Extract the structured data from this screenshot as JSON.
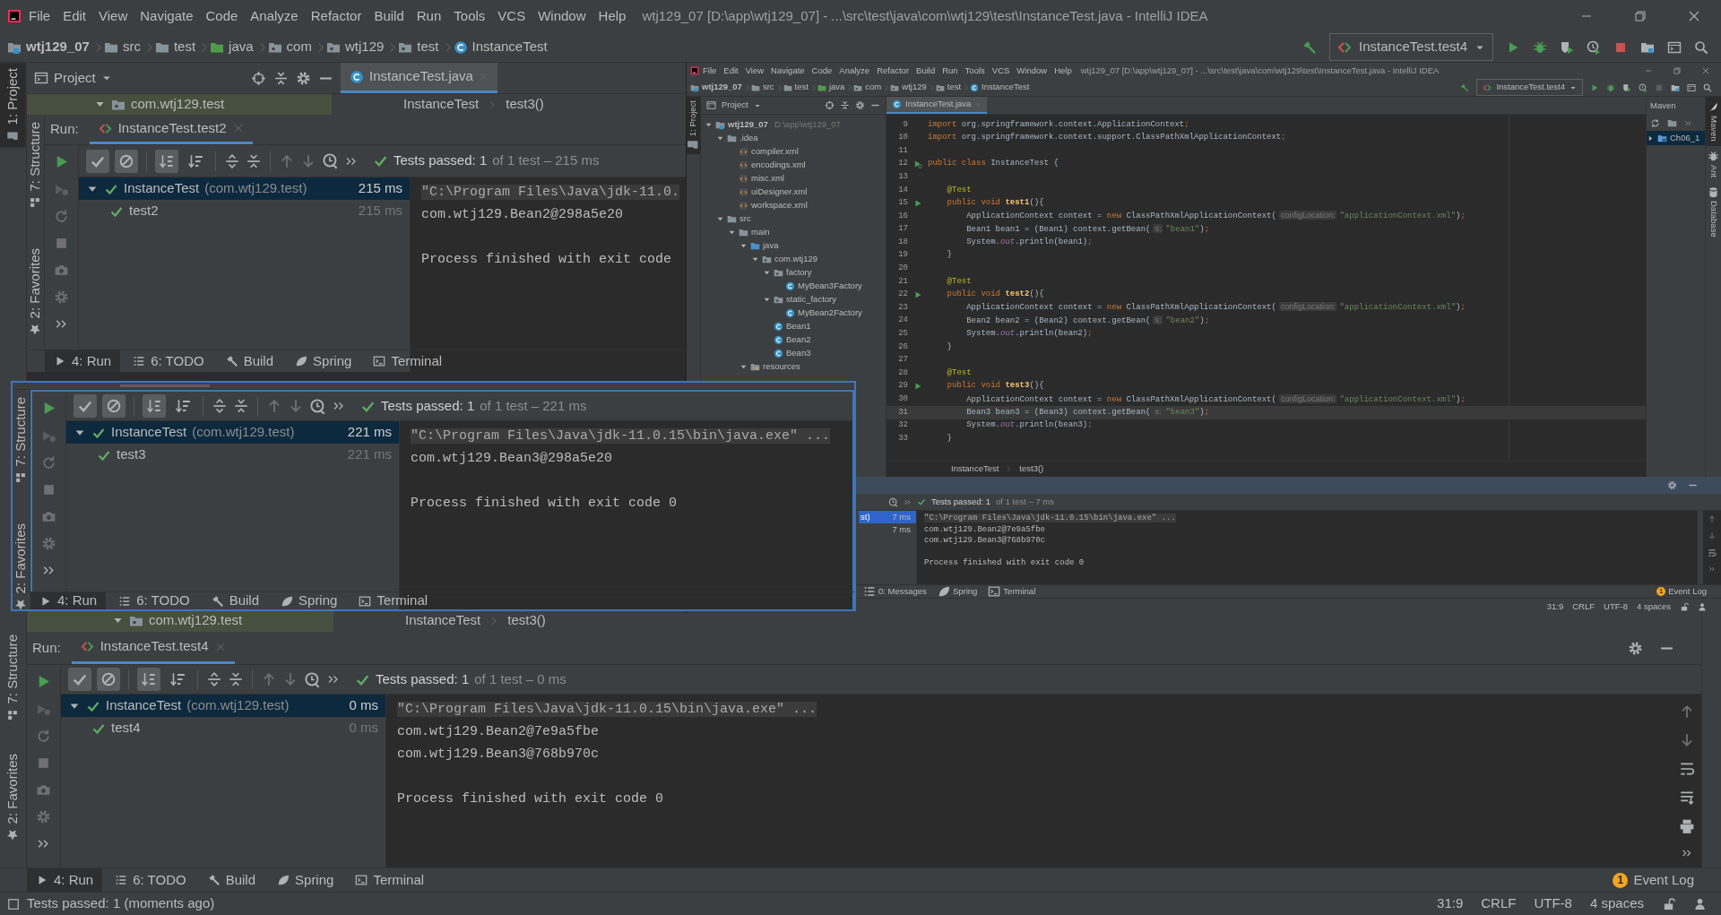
{
  "window": {
    "title": "wtj129_07 [D:\\app\\wtj129_07] - ...\\src\\test\\java\\com\\wtj129\\test\\InstanceTest.java - IntelliJ IDEA",
    "menu": [
      "File",
      "Edit",
      "View",
      "Navigate",
      "Code",
      "Analyze",
      "Refactor",
      "Build",
      "Run",
      "Tools",
      "VCS",
      "Window",
      "Help"
    ]
  },
  "navigation_bar": {
    "crumbs": [
      {
        "kind": "project",
        "label": "wtj129_07"
      },
      {
        "kind": "folder",
        "label": "src"
      },
      {
        "kind": "folder",
        "label": "test"
      },
      {
        "kind": "source",
        "label": "java"
      },
      {
        "kind": "package",
        "label": "com"
      },
      {
        "kind": "package",
        "label": "wtj129"
      },
      {
        "kind": "package",
        "label": "test"
      },
      {
        "kind": "class",
        "label": "InstanceTest"
      }
    ],
    "run_config": "InstanceTest.test4",
    "stop_active": true
  },
  "left_stripe": {
    "top": [
      "1: Project"
    ],
    "bottom": [
      "7: Structure",
      "2: Favorites"
    ]
  },
  "project_panel": {
    "title": "Project"
  },
  "editor_tabs": [
    {
      "label": "InstanceTest.java",
      "selected": true
    }
  ],
  "editor_breadcrumb": {
    "package": "com.wtj129.test",
    "path": [
      "InstanceTest",
      "test3()"
    ]
  },
  "run_panel": {
    "title": "Run:",
    "tab": "InstanceTest.test4",
    "toolbar": {
      "show_passed": true,
      "show_ignored": true,
      "sort_alphabetically": true,
      "sort_by_duration": false
    },
    "summary": {
      "passed": true,
      "status": "Tests passed: 1",
      "detail": "of 1 test – 0 ms"
    },
    "tree": [
      {
        "name": "InstanceTest",
        "package": "(com.wtj129.test)",
        "time": "0 ms",
        "passed": true,
        "selected": true,
        "expanded": true,
        "children": [
          {
            "name": "test4",
            "time": "0 ms",
            "passed": true,
            "selected": false
          }
        ]
      }
    ],
    "console": [
      {
        "kind": "command",
        "text": "\"C:\\Program Files\\Java\\jdk-11.0.15\\bin\\java.exe\" ..."
      },
      {
        "kind": "output",
        "text": "com.wtj129.Bean2@7e9a5fbe"
      },
      {
        "kind": "output",
        "text": "com.wtj129.Bean3@768b970c"
      },
      {
        "kind": "exit",
        "text": "Process finished with exit code 0"
      }
    ]
  },
  "tool_tabs": [
    {
      "label": "4: Run",
      "selected": true
    },
    {
      "label": "6: TODO",
      "selected": false
    },
    {
      "label": "Build",
      "selected": false
    },
    {
      "label": "Spring",
      "selected": false
    },
    {
      "label": "Terminal",
      "selected": false
    }
  ],
  "event_log": {
    "label": "Event Log",
    "count": "1"
  },
  "status_bar": {
    "message": "Tests passed: 1 (moments ago)",
    "items": [
      "31:9",
      "CRLF",
      "UTF-8",
      "4 spaces"
    ]
  },
  "pasted_run_panels": [
    {
      "breadcrumb": {
        "package": "com.wtj129.test",
        "path": [
          "InstanceTest",
          "test3()"
        ]
      },
      "title": "Run:",
      "tab": "InstanceTest.test2",
      "stripe": [
        "7: Structure",
        "2: Favorites"
      ],
      "toolbar": {
        "show_passed": true,
        "show_ignored": true,
        "sort_alphabetically": true,
        "sort_by_duration": false
      },
      "summary": {
        "passed": true,
        "status": "Tests passed: 1",
        "detail": "of 1 test – 215 ms"
      },
      "tree": [
        {
          "name": "InstanceTest",
          "package": "(com.wtj129.test)",
          "time": "215 ms",
          "passed": true,
          "selected": true,
          "expanded": true,
          "children": [
            {
              "name": "test2",
              "time": "215 ms",
              "passed": true,
              "selected": false
            }
          ]
        }
      ],
      "console": [
        {
          "kind": "command",
          "text": "\"C:\\Program Files\\Java\\jdk-11.0."
        },
        {
          "kind": "output",
          "text": "com.wtj129.Bean2@298a5e20"
        },
        {
          "kind": "exit",
          "text": "Process finished with exit code"
        }
      ],
      "tool_tabs": [
        {
          "label": "4: Run",
          "selected": true
        },
        {
          "label": "6: TODO",
          "selected": false
        },
        {
          "label": "Build",
          "selected": false
        },
        {
          "label": "Spring",
          "selected": false
        },
        {
          "label": "Terminal",
          "selected": false
        }
      ]
    },
    {
      "stripe": [
        "7: Structure",
        "2: Favorites"
      ],
      "toolbar": {
        "show_passed": true,
        "show_ignored": true,
        "sort_alphabetically": true,
        "sort_by_duration": false
      },
      "summary": {
        "passed": true,
        "status": "Tests passed: 1",
        "detail": "of 1 test – 221 ms"
      },
      "tree": [
        {
          "name": "InstanceTest",
          "package": "(com.wtj129.test)",
          "time": "221 ms",
          "passed": true,
          "selected": true,
          "expanded": true,
          "children": [
            {
              "name": "test3",
              "time": "221 ms",
              "passed": true,
              "selected": false
            }
          ]
        }
      ],
      "console": [
        {
          "kind": "command",
          "text": "\"C:\\Program Files\\Java\\jdk-11.0.15\\bin\\java.exe\" ..."
        },
        {
          "kind": "output",
          "text": "com.wtj129.Bean3@298a5e20"
        },
        {
          "kind": "exit",
          "text": "Process finished with exit code 0"
        }
      ],
      "tool_tabs": [
        {
          "label": "4: Run",
          "selected": true
        },
        {
          "label": "6: TODO",
          "selected": false
        },
        {
          "label": "Build",
          "selected": false
        },
        {
          "label": "Spring",
          "selected": false
        },
        {
          "label": "Terminal",
          "selected": false
        }
      ]
    }
  ],
  "pasted_ide": {
    "title": "wtj129_07 [D:\\app\\wtj129_07] - ...\\src\\test\\java\\com\\wtj129\\test\\InstanceTest.java - IntelliJ IDEA",
    "menu": [
      "File",
      "Edit",
      "View",
      "Navigate",
      "Code",
      "Analyze",
      "Refactor",
      "Build",
      "Run",
      "Tools",
      "VCS",
      "Window",
      "Help"
    ],
    "crumbs": [
      {
        "kind": "project",
        "label": "wtj129_07"
      },
      {
        "kind": "folder",
        "label": "src"
      },
      {
        "kind": "folder",
        "label": "test"
      },
      {
        "kind": "source",
        "label": "java"
      },
      {
        "kind": "package",
        "label": "com"
      },
      {
        "kind": "package",
        "label": "wtj129"
      },
      {
        "kind": "package",
        "label": "test"
      },
      {
        "kind": "class",
        "label": "InstanceTest"
      }
    ],
    "run_config": "InstanceTest.test4",
    "stop_active": false,
    "left_stripe": [
      "1: Project"
    ],
    "project_panel": {
      "title": "Project",
      "tree": [
        {
          "name": "wtj129_07",
          "path": "D:\\app\\wtj129_07",
          "kind": "project",
          "expanded": true,
          "children": [
            {
              "name": ".idea",
              "kind": "folder",
              "expanded": true,
              "children": [
                {
                  "name": "compiler.xml",
                  "kind": "xml"
                },
                {
                  "name": "encodings.xml",
                  "kind": "xml"
                },
                {
                  "name": "misc.xml",
                  "kind": "xml"
                },
                {
                  "name": "uiDesigner.xml",
                  "kind": "xml"
                },
                {
                  "name": "workspace.xml",
                  "kind": "xml"
                }
              ]
            },
            {
              "name": "src",
              "kind": "folder",
              "expanded": true,
              "children": [
                {
                  "name": "main",
                  "kind": "folder",
                  "expanded": true,
                  "children": [
                    {
                      "name": "java",
                      "kind": "source",
                      "expanded": true,
                      "children": [
                        {
                          "name": "com.wtj129",
                          "kind": "package",
                          "expanded": true,
                          "children": [
                            {
                              "name": "factory",
                              "kind": "package",
                              "expanded": true,
                              "children": [
                                {
                                  "name": "MyBean3Factory",
                                  "kind": "class"
                                }
                              ]
                            },
                            {
                              "name": "static_factory",
                              "kind": "package",
                              "expanded": true,
                              "children": [
                                {
                                  "name": "MyBean2Factory",
                                  "kind": "class"
                                }
                              ]
                            },
                            {
                              "name": "Bean1",
                              "kind": "class"
                            },
                            {
                              "name": "Bean2",
                              "kind": "class"
                            },
                            {
                              "name": "Bean3",
                              "kind": "class"
                            }
                          ]
                        }
                      ]
                    },
                    {
                      "name": "resources",
                      "kind": "resources",
                      "expanded": true
                    }
                  ]
                }
              ]
            }
          ]
        }
      ]
    },
    "editor_tabs": [
      {
        "label": "InstanceTest.java",
        "selected": true
      }
    ],
    "code": [
      {
        "number": "9",
        "current": false,
        "tokens": [
          {
            "kind": "keyword",
            "text": "import"
          },
          {
            "kind": "plain",
            "text": " org.springframework.context.ApplicationContext"
          },
          {
            "kind": "keyword",
            "text": ";"
          }
        ]
      },
      {
        "number": "10",
        "current": false,
        "tokens": [
          {
            "kind": "keyword",
            "text": "import"
          },
          {
            "kind": "plain",
            "text": " org.springframework.context.support.ClassPathXmlApplicationContext"
          },
          {
            "kind": "keyword",
            "text": ";"
          }
        ]
      },
      {
        "number": "11",
        "current": false
      },
      {
        "number": "12",
        "current": false,
        "kind": "run_class",
        "tokens": [
          {
            "kind": "keyword",
            "text": "public class "
          },
          {
            "kind": "plain",
            "text": "InstanceTest {"
          }
        ]
      },
      {
        "number": "13",
        "current": false
      },
      {
        "number": "14",
        "current": false,
        "tokens": [
          {
            "kind": "annotation",
            "text": "    @Test"
          }
        ]
      },
      {
        "number": "15",
        "current": false,
        "kind": "run",
        "tokens": [
          {
            "kind": "keyword",
            "text": "    public void "
          },
          {
            "kind": "method",
            "text": "test1"
          },
          {
            "kind": "plain",
            "text": "(){"
          }
        ]
      },
      {
        "number": "16",
        "current": false,
        "tokens": [
          {
            "kind": "plain",
            "text": "        ApplicationContext context = "
          },
          {
            "kind": "keyword",
            "text": "new "
          },
          {
            "kind": "plain",
            "text": "ClassPathXmlApplicationContext("
          },
          {
            "kind": "hint",
            "text": "configLocation:"
          },
          {
            "kind": "string",
            "text": "\"applicationContext.xml\""
          },
          {
            "kind": "plain",
            "text": ")"
          },
          {
            "kind": "keyword",
            "text": ";"
          }
        ]
      },
      {
        "number": "17",
        "current": false,
        "tokens": [
          {
            "kind": "plain",
            "text": "        Bean1 bean1 = (Bean1) context.getBean("
          },
          {
            "kind": "hint",
            "text": "s:"
          },
          {
            "kind": "string",
            "text": "\"bean1\""
          },
          {
            "kind": "plain",
            "text": ")"
          },
          {
            "kind": "keyword",
            "text": ";"
          }
        ]
      },
      {
        "number": "18",
        "current": false,
        "tokens": [
          {
            "kind": "plain",
            "text": "        System."
          },
          {
            "kind": "field",
            "text": "out"
          },
          {
            "kind": "plain",
            "text": ".println(bean1)"
          },
          {
            "kind": "keyword",
            "text": ";"
          }
        ]
      },
      {
        "number": "19",
        "current": false,
        "tokens": [
          {
            "kind": "plain",
            "text": "    }"
          }
        ]
      },
      {
        "number": "20",
        "current": false
      },
      {
        "number": "21",
        "current": false,
        "tokens": [
          {
            "kind": "annotation",
            "text": "    @Test"
          }
        ]
      },
      {
        "number": "22",
        "current": false,
        "kind": "run",
        "tokens": [
          {
            "kind": "keyword",
            "text": "    public void "
          },
          {
            "kind": "method",
            "text": "test2"
          },
          {
            "kind": "plain",
            "text": "(){"
          }
        ]
      },
      {
        "number": "23",
        "current": false,
        "tokens": [
          {
            "kind": "plain",
            "text": "        ApplicationContext context = "
          },
          {
            "kind": "keyword",
            "text": "new "
          },
          {
            "kind": "plain",
            "text": "ClassPathXmlApplicationContext("
          },
          {
            "kind": "hint",
            "text": "configLocation:"
          },
          {
            "kind": "string",
            "text": "\"applicationContext.xml\""
          },
          {
            "kind": "plain",
            "text": ")"
          },
          {
            "kind": "keyword",
            "text": ";"
          }
        ]
      },
      {
        "number": "24",
        "current": false,
        "tokens": [
          {
            "kind": "plain",
            "text": "        Bean2 bean2 = (Bean2) context.getBean("
          },
          {
            "kind": "hint",
            "text": "s:"
          },
          {
            "kind": "string",
            "text": "\"bean2\""
          },
          {
            "kind": "plain",
            "text": ")"
          },
          {
            "kind": "keyword",
            "text": ";"
          }
        ]
      },
      {
        "number": "25",
        "current": false,
        "tokens": [
          {
            "kind": "plain",
            "text": "        System."
          },
          {
            "kind": "field",
            "text": "out"
          },
          {
            "kind": "plain",
            "text": ".println(bean2)"
          },
          {
            "kind": "keyword",
            "text": ";"
          }
        ]
      },
      {
        "number": "26",
        "current": false,
        "tokens": [
          {
            "kind": "plain",
            "text": "    }"
          }
        ]
      },
      {
        "number": "27",
        "current": false
      },
      {
        "number": "28",
        "current": false,
        "tokens": [
          {
            "kind": "annotation",
            "text": "    @Test"
          }
        ]
      },
      {
        "number": "29",
        "current": false,
        "kind": "run",
        "tokens": [
          {
            "kind": "keyword",
            "text": "    public void "
          },
          {
            "kind": "method",
            "text": "test3"
          },
          {
            "kind": "plain",
            "text": "(){"
          }
        ]
      },
      {
        "number": "30",
        "current": false,
        "tokens": [
          {
            "kind": "plain",
            "text": "        ApplicationContext context = "
          },
          {
            "kind": "keyword",
            "text": "new "
          },
          {
            "kind": "plain",
            "text": "ClassPathXmlApplicationContext("
          },
          {
            "kind": "hint",
            "text": "configLocation:"
          },
          {
            "kind": "string",
            "text": "\"applicationContext.xml\""
          },
          {
            "kind": "plain",
            "text": ")"
          },
          {
            "kind": "keyword",
            "text": ";"
          }
        ]
      },
      {
        "number": "31",
        "current": true,
        "tokens": [
          {
            "kind": "plain",
            "text": "        Bean3 bean3 = (Bean3) context.getBean("
          },
          {
            "kind": "hint",
            "text": "s:"
          },
          {
            "kind": "string",
            "text": "\"bean3\""
          },
          {
            "kind": "plain",
            "text": ")"
          },
          {
            "kind": "keyword",
            "text": ";"
          }
        ]
      },
      {
        "number": "32",
        "current": false,
        "tokens": [
          {
            "kind": "plain",
            "text": "        System."
          },
          {
            "kind": "field",
            "text": "out"
          },
          {
            "kind": "plain",
            "text": ".println(bean3)"
          },
          {
            "kind": "keyword",
            "text": ";"
          }
        ]
      },
      {
        "number": "33",
        "current": false,
        "tokens": [
          {
            "kind": "plain",
            "text": "    }"
          }
        ]
      }
    ],
    "editor_breadcrumb": [
      "InstanceTest",
      "test3()"
    ],
    "maven": {
      "title": "Maven",
      "items": [
        {
          "label": "Ch06_1",
          "expanded": false,
          "selected": true
        }
      ]
    },
    "right_stripe": [
      "Maven",
      "Ant",
      "Database"
    ],
    "run_panel": {
      "summary": {
        "passed": true,
        "status": "Tests passed: 1",
        "detail": "of 1 test – 7 ms"
      },
      "tree": [
        {
          "name": "st)",
          "time": "7 ms",
          "selected": true
        },
        {
          "time": "7 ms",
          "selected": false
        }
      ],
      "console": [
        {
          "kind": "command",
          "text": "\"C:\\Program Files\\Java\\jdk-11.0.15\\bin\\java.exe\" ..."
        },
        {
          "kind": "output",
          "text": "com.wtj129.Bean2@7e9a5fbe"
        },
        {
          "kind": "output",
          "text": "com.wtj129.Bean3@768b970c"
        },
        {
          "kind": "exit",
          "text": "Process finished with exit code 0"
        }
      ]
    },
    "tool_tabs": [
      {
        "label": "0: Messages",
        "selected": false
      },
      {
        "label": "Spring",
        "selected": false
      },
      {
        "label": "Terminal",
        "selected": false
      }
    ],
    "event_log": {
      "label": "Event Log",
      "count": "1"
    },
    "status_bar": [
      "31:9",
      "CRLF",
      "UTF-8",
      "4 spaces"
    ]
  }
}
